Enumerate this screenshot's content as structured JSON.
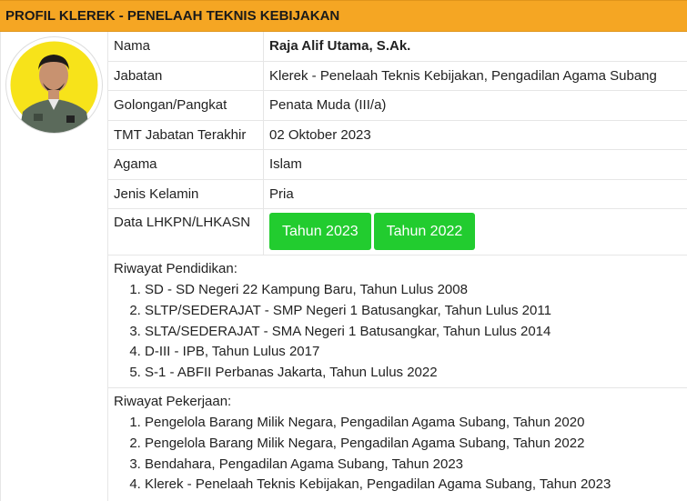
{
  "header": {
    "title": "PROFIL KLEREK - PENELAAH TEKNIS KEBIJAKAN"
  },
  "profile": {
    "rows": [
      {
        "label": "Nama",
        "value": "Raja Alif Utama, S.Ak."
      },
      {
        "label": "Jabatan",
        "value": "Klerek - Penelaah Teknis Kebijakan, Pengadilan Agama Subang"
      },
      {
        "label": "Golongan/Pangkat",
        "value": "Penata Muda (III/a)"
      },
      {
        "label": "TMT Jabatan Terakhir",
        "value": "02 Oktober 2023"
      },
      {
        "label": "Agama",
        "value": "Islam"
      },
      {
        "label": "Jenis Kelamin",
        "value": "Pria"
      }
    ],
    "lhkpn": {
      "label": "Data LHKPN/LHKASN",
      "buttons": [
        "Tahun 2023",
        "Tahun 2022"
      ]
    }
  },
  "education": {
    "title": "Riwayat Pendidikan:",
    "items": [
      "SD - SD Negeri 22 Kampung Baru, Tahun Lulus 2008",
      "SLTP/SEDERAJAT - SMP Negeri 1 Batusangkar, Tahun Lulus 2011",
      "SLTA/SEDERAJAT - SMA Negeri 1 Batusangkar, Tahun Lulus 2014",
      "D-III - IPB, Tahun Lulus 2017",
      "S-1 - ABFII Perbanas Jakarta, Tahun Lulus 2022"
    ]
  },
  "work": {
    "title": "Riwayat Pekerjaan:",
    "items": [
      "Pengelola Barang Milik Negara, Pengadilan Agama Subang, Tahun 2020",
      "Pengelola Barang Milik Negara, Pengadilan Agama Subang, Tahun 2022",
      "Bendahara, Pengadilan Agama Subang, Tahun 2023",
      "Klerek - Penelaah Teknis Kebijakan, Pengadilan Agama Subang, Tahun 2023"
    ]
  },
  "colors": {
    "header": "#f5a623",
    "button": "#22cc2f",
    "photo_bg": "#f7e31a"
  }
}
